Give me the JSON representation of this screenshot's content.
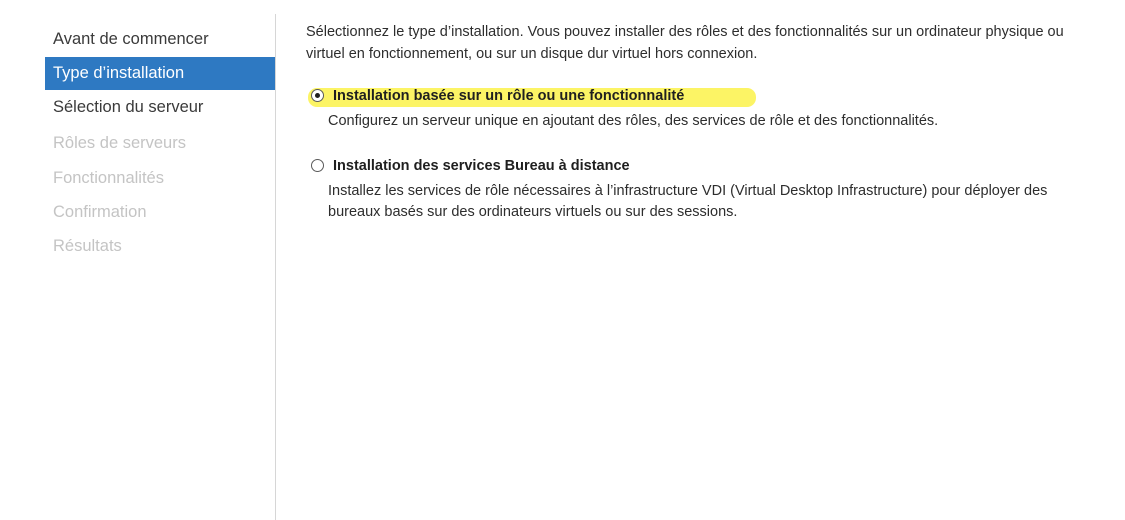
{
  "nav": {
    "items": [
      {
        "label": "Avant de commencer",
        "state": "normal"
      },
      {
        "label": "Type d’installation",
        "state": "active"
      },
      {
        "label": "Sélection du serveur",
        "state": "normal"
      },
      {
        "label": "Rôles de serveurs",
        "state": "disabled"
      },
      {
        "label": "Fonctionnalités",
        "state": "disabled"
      },
      {
        "label": "Confirmation",
        "state": "disabled"
      },
      {
        "label": "Résultats",
        "state": "disabled"
      }
    ]
  },
  "main": {
    "intro": "Sélectionnez le type d’installation. Vous pouvez installer des rôles et des fonctionnalités sur un ordinateur physique ou virtuel en fonctionnement, ou sur un disque dur virtuel hors connexion.",
    "options": [
      {
        "title": "Installation basée sur un rôle ou une fonctionnalité",
        "description": "Configurez un serveur unique en ajoutant des rôles, des services de rôle et des fonctionnalités.",
        "selected": true,
        "highlighted": true
      },
      {
        "title": "Installation des services Bureau à distance",
        "description": "Installez les services de rôle nécessaires à l’infrastructure VDI (Virtual Desktop Infrastructure) pour déployer des bureaux basés sur des ordinateurs virtuels ou sur des sessions.",
        "selected": false,
        "highlighted": false
      }
    ]
  },
  "colors": {
    "active_nav_background": "#2e79c2",
    "disabled_nav_text": "#c4c4c4",
    "highlighter": "#fbf24a"
  }
}
